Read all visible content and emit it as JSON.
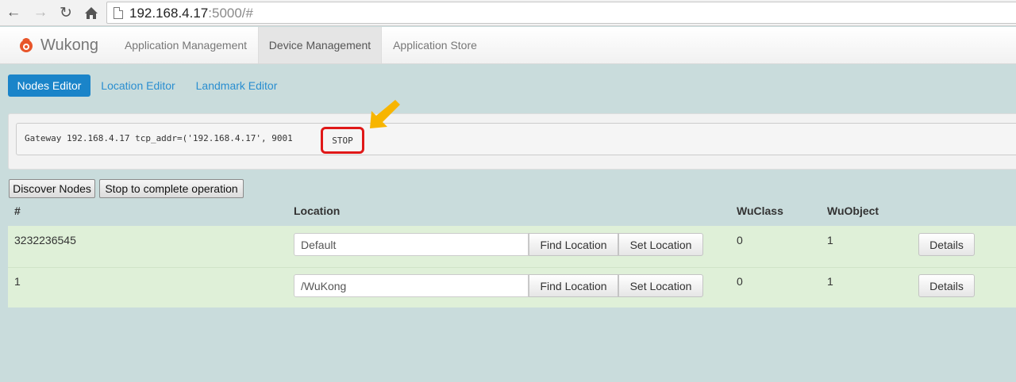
{
  "browser": {
    "url_host": "192.168.4.17",
    "url_rest": ":5000/#"
  },
  "navbar": {
    "brand": "Wukong",
    "tabs": [
      "Application Management",
      "Device Management",
      "Application Store"
    ],
    "active_tab": "Device Management"
  },
  "subtabs": {
    "items": [
      "Nodes Editor",
      "Location Editor",
      "Landmark Editor"
    ],
    "active": "Nodes Editor"
  },
  "gateway": {
    "text": "Gateway 192.168.4.17 tcp_addr=('192.168.4.17', 9001",
    "stop_label": "STOP"
  },
  "actions": {
    "discover": "Discover Nodes",
    "stop_complete": "Stop to complete operation"
  },
  "table": {
    "headers": [
      "#",
      "Location",
      "WuClass",
      "WuObject"
    ],
    "find_label": "Find Location",
    "set_label": "Set Location",
    "details_label": "Details",
    "rows": [
      {
        "id": "3232236545",
        "location": "Default",
        "wuclass": "0",
        "wuobject": "1"
      },
      {
        "id": "1",
        "location": "/WuKong",
        "wuclass": "0",
        "wuobject": "1"
      }
    ]
  },
  "colors": {
    "primary": "#1a84c9",
    "row_bg": "#dff0d8",
    "page_bg": "#c9dcdc",
    "highlight": "#e01818",
    "arrow": "#f7b500"
  },
  "icons": [
    "back-icon",
    "forward-icon",
    "reload-icon",
    "home-icon",
    "page-icon",
    "wukong-logo-icon",
    "pointer-arrow-icon"
  ]
}
